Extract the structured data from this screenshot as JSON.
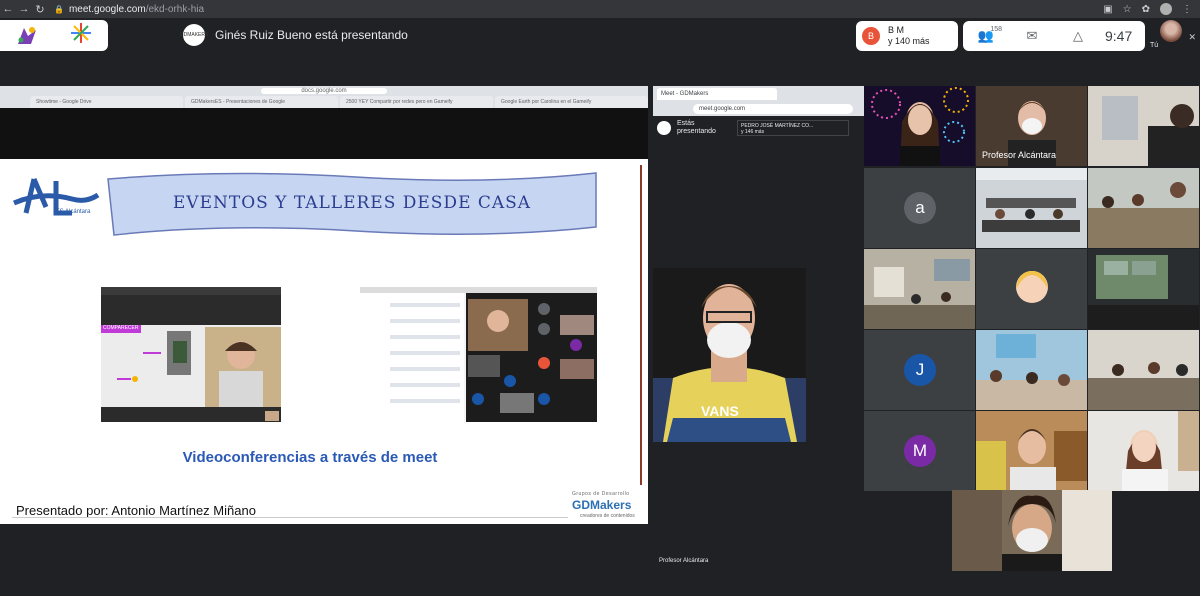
{
  "browser": {
    "url_host": "meet.google.com",
    "url_path": "/ekd-orhk-hia"
  },
  "meet_header": {
    "presenter_text": "Ginés Ruiz Bueno está presentando",
    "presenter_avatar_text": "GDMAKERS",
    "joined_initial": "B",
    "joined_line1": "B M",
    "joined_line2": "y 140 más",
    "participants_count": "158",
    "clock": "9:47",
    "self_label": "Tú"
  },
  "slide": {
    "inner_url": "docs.google.com",
    "tabs": [
      "Showtime - Google Drive",
      "GDMakersES - Presentaciones de Google",
      "2500 YEY Compartir por redes pero en Gameify",
      "Google Earth por Carolina en el Gameify"
    ],
    "logo_text": "IES Alcántara",
    "banner_title": "EVENTOS Y TALLERES DESDE CASA",
    "caption": "Videoconferencias a través de meet",
    "presenter": "Presentado por:  Antonio Martínez Miñano",
    "gd_small": "Grupos de Desarrollo",
    "gd_big": "GDMakers",
    "gd_sub": "creadores de contenidos",
    "shot1_label": "COMPARECER"
  },
  "share2": {
    "tab": "Meet - GDMakers",
    "url": "meet.google.com",
    "present_line1": "Estás",
    "present_line2": "presentando",
    "presenter_line1": "PEDRO JOSÉ MARTÍNEZ CO...",
    "presenter_line2": "y 146 más",
    "caption": "Profesor Alcántara"
  },
  "grid": {
    "tile_profesor": "Profesor Alcántara",
    "avatar_a": "a",
    "avatar_j": "J",
    "avatar_m": "M"
  },
  "colors": {
    "avatar_a": "#5f6368",
    "avatar_j": "#1a56a8",
    "avatar_m": "#7b2aa6",
    "joined_av": "#e8543a",
    "slide_caption": "#2a59b6"
  }
}
